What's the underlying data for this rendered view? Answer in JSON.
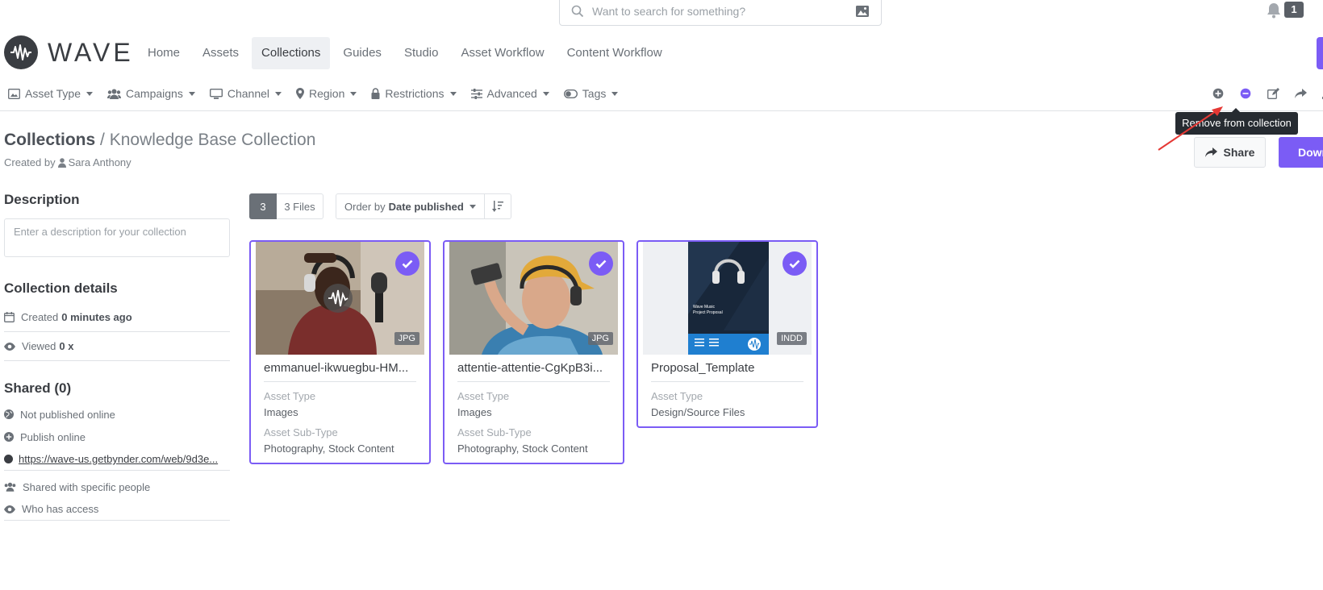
{
  "search": {
    "placeholder": "Want to search for something?"
  },
  "notifications": {
    "count": "1"
  },
  "brand": {
    "name": "WAVE",
    "accent": "#7b5cf5"
  },
  "nav": {
    "items": [
      "Home",
      "Assets",
      "Collections",
      "Guides",
      "Studio",
      "Asset Workflow",
      "Content Workflow"
    ],
    "active": "Collections"
  },
  "filters": [
    "Asset Type",
    "Campaigns",
    "Channel",
    "Region",
    "Restrictions",
    "Advanced",
    "Tags"
  ],
  "actions": {
    "icons": [
      "add-circle-icon",
      "remove-circle-icon",
      "edit-icon",
      "share-icon",
      "download-icon"
    ],
    "tooltip": "Remove from collection"
  },
  "header": {
    "crumb": "Collections",
    "separator": "/",
    "current": "Knowledge Base Collection",
    "created_by_prefix": "Created by",
    "created_by_name": "Sara Anthony",
    "share_label": "Share",
    "download_label": "Download"
  },
  "sidebar": {
    "description_heading": "Description",
    "description_placeholder": "Enter a description for your collection",
    "details_heading": "Collection details",
    "created_label": "Created",
    "created_value": "0 minutes ago",
    "viewed_label": "Viewed",
    "viewed_value": "0 x",
    "shared_heading": "Shared (0)",
    "not_published": "Not published online",
    "publish_online": "Publish online",
    "link": "https://wave-us.getbynder.com/web/9d3e...",
    "shared_people": "Shared with specific people",
    "who_access": "Who has access"
  },
  "toolbar": {
    "count": "3",
    "files": "3 Files",
    "order_prefix": "Order by",
    "order_value": "Date published"
  },
  "assets": [
    {
      "title": "emmanuel-ikwuegbu-HM...",
      "ext": "JPG",
      "type_label": "Asset Type",
      "type": "Images",
      "subtype_label": "Asset Sub-Type",
      "subtype": "Photography, Stock Content"
    },
    {
      "title": "attentie-attentie-CgKpB3i...",
      "ext": "JPG",
      "type_label": "Asset Type",
      "type": "Images",
      "subtype_label": "Asset Sub-Type",
      "subtype": "Photography, Stock Content"
    },
    {
      "title": "Proposal_Template",
      "ext": "INDD",
      "type_label": "Asset Type",
      "type": "Design/Source Files",
      "thumb_text_1": "Wave Music",
      "thumb_text_2": "Project Proposal"
    }
  ]
}
